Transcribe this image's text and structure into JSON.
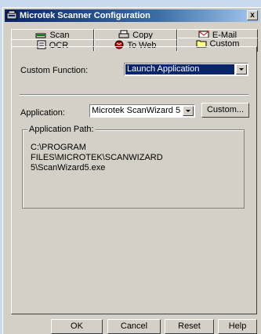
{
  "window": {
    "title": "Microtek Scanner Configuration",
    "close_glyph": "x"
  },
  "tabs": {
    "row1": [
      {
        "label": "Scan",
        "icon": "scanner-icon"
      },
      {
        "label": "Copy",
        "icon": "printer-icon"
      },
      {
        "label": "E-Mail",
        "icon": "email-icon"
      }
    ],
    "row2": [
      {
        "label": "OCR",
        "icon": "ocr-icon"
      },
      {
        "label": "To Web",
        "icon": "globe-icon"
      },
      {
        "label": "Custom",
        "icon": "folder-icon"
      }
    ]
  },
  "custom": {
    "function_label": "Custom Function:",
    "function_value": "Launch Application",
    "application_label": "Application:",
    "application_value": "Microtek ScanWizard 5",
    "custom_button": "Custom...",
    "path_group_label": "Application Path:",
    "path_value": "C:\\PROGRAM FILES\\MICROTEK\\SCANWIZARD 5\\ScanWizard5.exe"
  },
  "buttons": {
    "ok": "OK",
    "cancel": "Cancel",
    "reset": "Reset",
    "help": "Help"
  }
}
